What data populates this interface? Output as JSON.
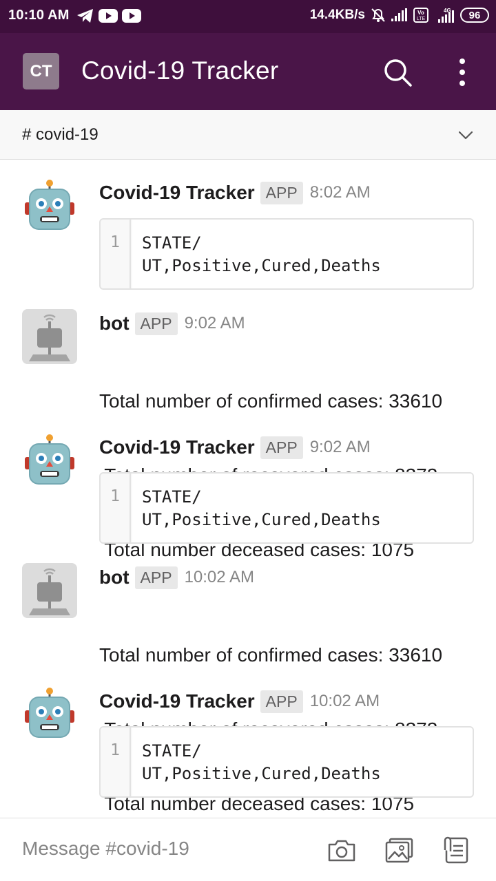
{
  "status_bar": {
    "time": "10:10 AM",
    "net_speed": "14.4KB/s",
    "battery": "96",
    "icons": [
      "telegram-icon",
      "youtube-icon",
      "youtube-icon",
      "mute-bell-icon",
      "signal-icon",
      "volte-icon",
      "4g-signal-icon",
      "battery-icon"
    ]
  },
  "header": {
    "workspace_initials": "CT",
    "title": "Covid-19 Tracker",
    "actions": [
      "search-icon",
      "more-vertical-icon"
    ]
  },
  "channel": {
    "name": "# covid-19",
    "dropdown_icon": "chevron-down-icon"
  },
  "messages": [
    {
      "sender": "Covid-19 Tracker",
      "tag": "APP",
      "time": "8:02 AM",
      "avatar": "robot-face-icon",
      "code_line_no": "1",
      "code_line_1": "STATE/",
      "code_line_2": "UT,Positive,Cured,Deaths"
    },
    {
      "sender": "bot",
      "tag": "APP",
      "time": "9:02 AM",
      "avatar": "bot-avatar-icon",
      "line_1": "Total number of confirmed cases: 33610",
      "line_2": " Total number of recovered cases: 8373",
      "line_3": " Total number deceased cases: 1075"
    },
    {
      "sender": "Covid-19 Tracker",
      "tag": "APP",
      "time": "9:02 AM",
      "avatar": "robot-face-icon",
      "code_line_no": "1",
      "code_line_1": "STATE/",
      "code_line_2": "UT,Positive,Cured,Deaths"
    },
    {
      "sender": "bot",
      "tag": "APP",
      "time": "10:02 AM",
      "avatar": "bot-avatar-icon",
      "line_1": "Total number of confirmed cases: 33610",
      "line_2": " Total number of recovered cases: 8373",
      "line_3": " Total number deceased cases: 1075"
    },
    {
      "sender": "Covid-19 Tracker",
      "tag": "APP",
      "time": "10:02 AM",
      "avatar": "robot-face-icon",
      "code_line_no": "1",
      "code_line_1": "STATE/",
      "code_line_2": "UT,Positive,Cured,Deaths"
    }
  ],
  "composer": {
    "placeholder": "Message #covid-19",
    "actions": [
      "camera-icon",
      "gallery-icon",
      "attach-file-icon"
    ]
  },
  "colors": {
    "status_bar_bg": "#3e0f3c",
    "header_bg": "#4a1548",
    "workspace_badge": "#8e7b8c",
    "channel_bar_bg": "#f8f8f8"
  }
}
